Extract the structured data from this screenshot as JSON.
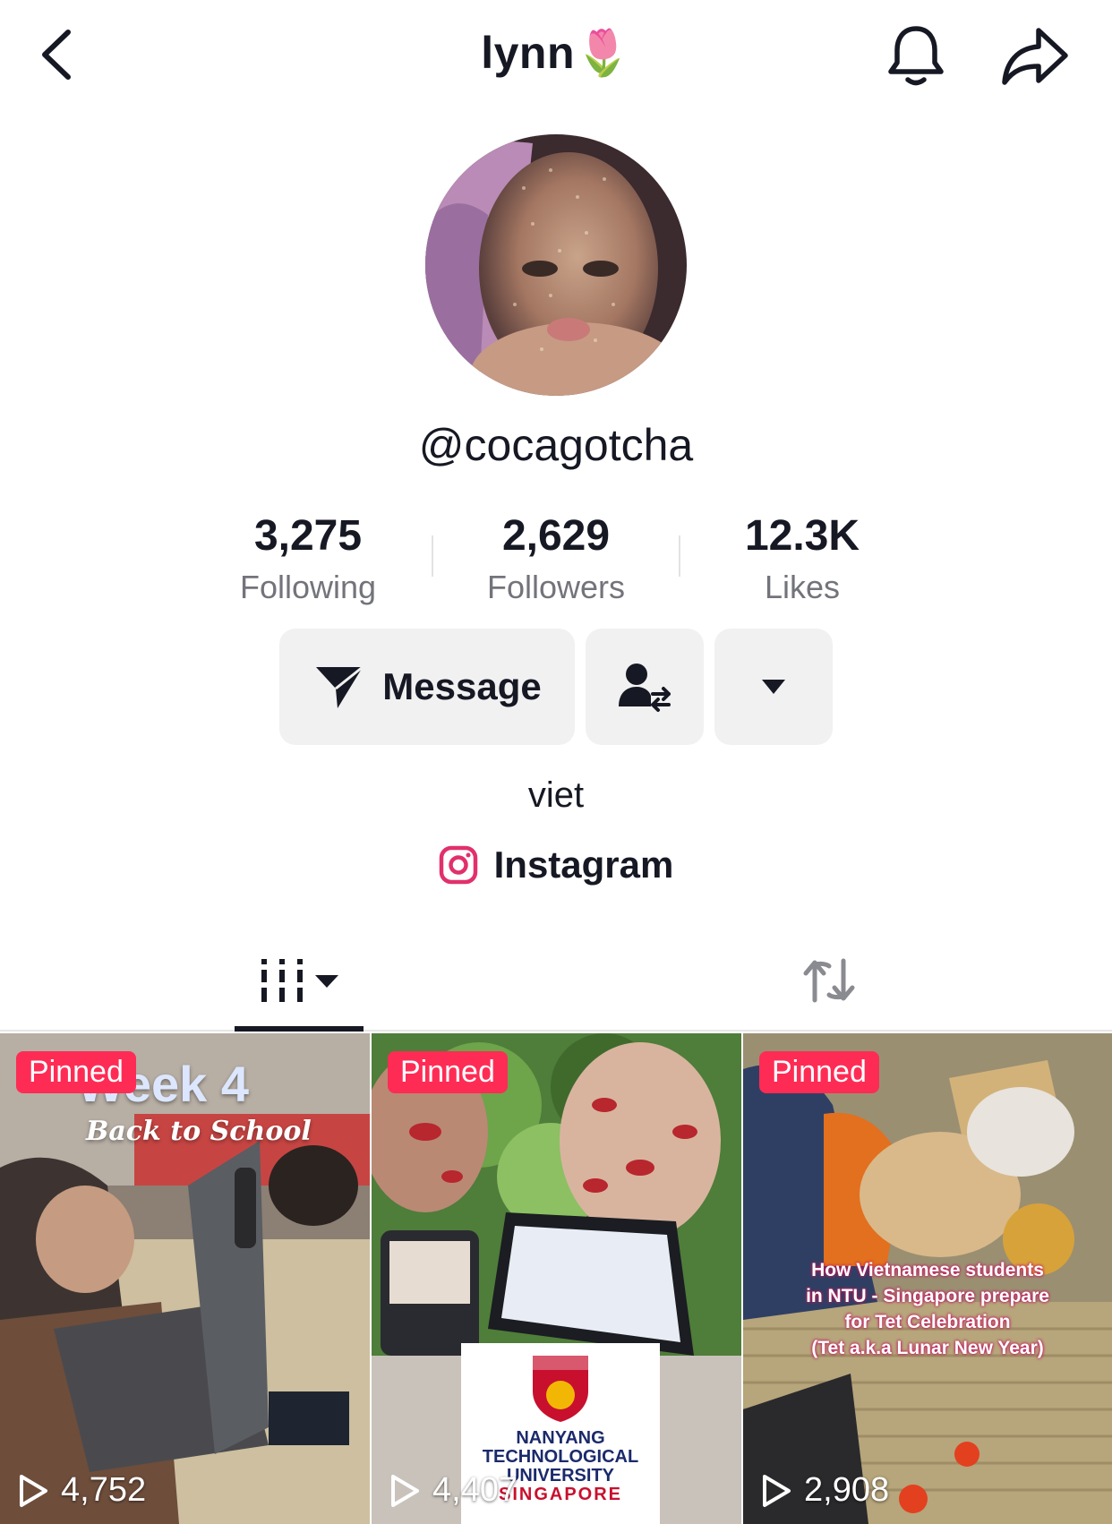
{
  "header": {
    "title": "lynn🌷",
    "back_icon": "chevron-left-icon",
    "bell_icon": "bell-icon",
    "share_icon": "share-arrow-icon"
  },
  "profile": {
    "handle": "@cocagotcha",
    "bio": "viet",
    "link_label": "Instagram"
  },
  "stats": [
    {
      "value": "3,275",
      "label": "Following"
    },
    {
      "value": "2,629",
      "label": "Followers"
    },
    {
      "value": "12.3K",
      "label": "Likes"
    }
  ],
  "actions": {
    "message_label": "Message"
  },
  "tabs": {
    "videos_icon": "videos-grid-icon",
    "reposts_icon": "repost-icon"
  },
  "videos": [
    {
      "badge": "Pinned",
      "views": "4,752",
      "title": "Week 4",
      "subtitle": "Back to School"
    },
    {
      "badge": "Pinned",
      "views": "4,407",
      "logo_lines": [
        "NANYANG",
        "TECHNOLOGICAL",
        "UNIVERSITY",
        "SINGAPORE"
      ]
    },
    {
      "badge": "Pinned",
      "views": "2,908",
      "caption_lines": [
        "How Vietnamese students",
        "in NTU - Singapore prepare",
        "for Tet Celebration",
        "(Tet a.k.a Lunar New Year)"
      ]
    }
  ],
  "colors": {
    "accent": "#fe2c55",
    "button_bg": "#f1f1f2",
    "secondary_text": "#73747b"
  }
}
